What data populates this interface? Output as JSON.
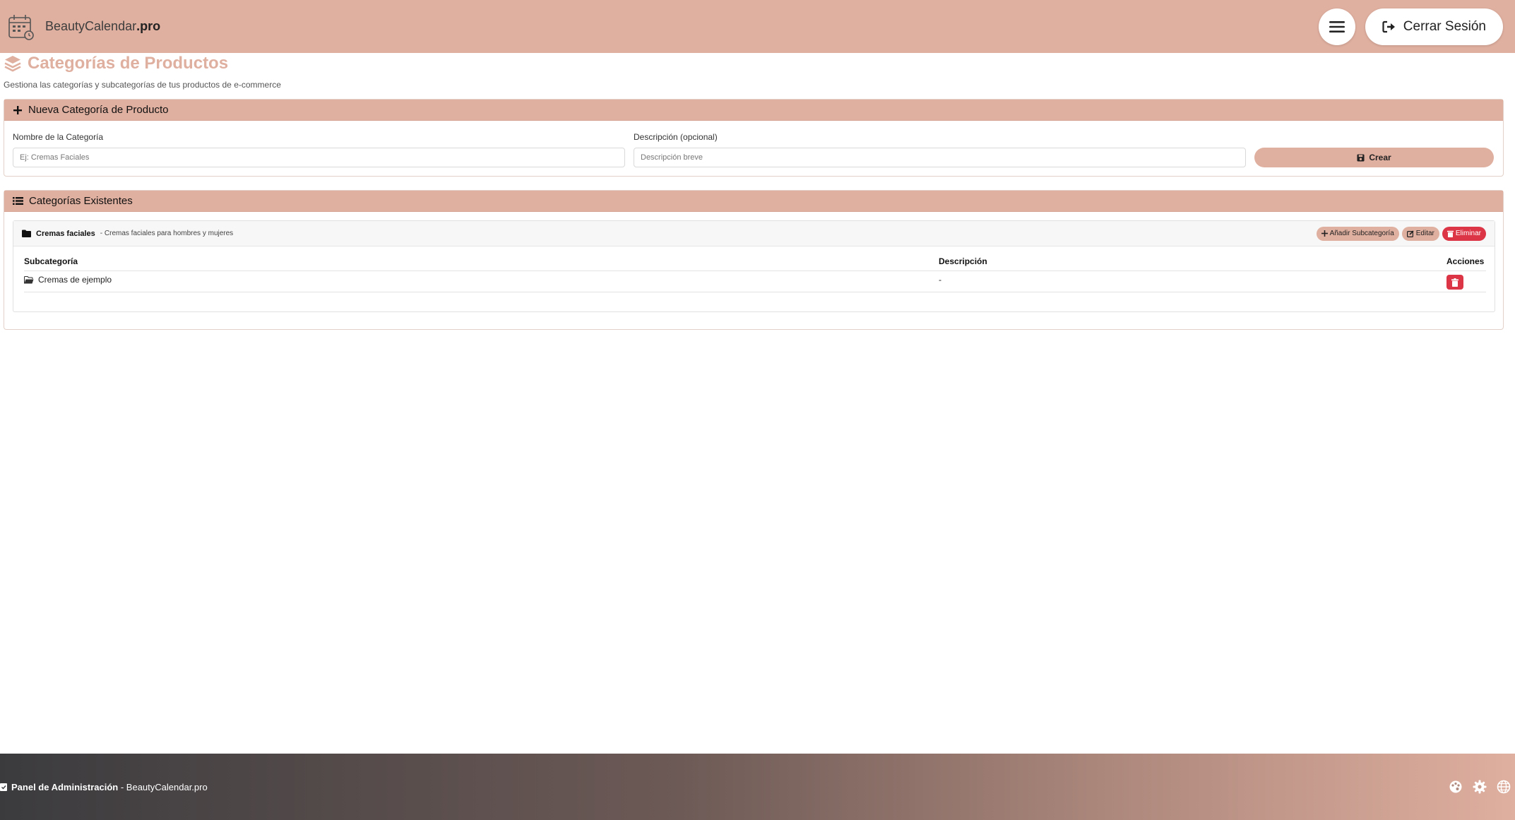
{
  "header": {
    "brand_name": "BeautyCalendar",
    "brand_suffix": ".pro",
    "menu_icon": "hamburger-icon",
    "logout_label": "Cerrar Sesión",
    "logout_icon": "sign-out-icon",
    "accent_color": "#dfaf9f"
  },
  "page": {
    "title": "Categorías de Productos",
    "title_icon": "layers-icon",
    "subtitle": "Gestiona las categorías y subcategorías de tus productos de e-commerce"
  },
  "new_category": {
    "header": "Nueva Categoría de Producto",
    "header_icon": "plus-icon",
    "name_label": "Nombre de la Categoría",
    "name_placeholder": "Ej: Cremas Faciales",
    "name_value": "",
    "desc_label": "Descripción (opcional)",
    "desc_placeholder": "Descripción breve",
    "desc_value": "",
    "create_label": "Crear",
    "create_icon": "save-icon"
  },
  "existing": {
    "header": "Categorías Existentes",
    "header_icon": "list-icon",
    "categories": [
      {
        "name": "Cremas faciales",
        "separator": " - ",
        "description": "Cremas faciales para hombres y mujeres",
        "icon": "folder-icon",
        "actions": {
          "add_sub": "Añadir Subcategoría",
          "edit": "Editar",
          "delete": "Eliminar"
        },
        "columns": [
          "Subcategoría",
          "Descripción",
          "Acciones"
        ],
        "subcategories": [
          {
            "name": "Cremas de ejemplo",
            "description": "-",
            "icon": "folder-open-icon"
          }
        ]
      }
    ]
  },
  "footer": {
    "title": "Panel de Administración",
    "separator": " - ",
    "site": "BeautyCalendar.pro",
    "icons": [
      "palette-icon",
      "gear-icon",
      "globe-icon"
    ],
    "danger_color": "#dc3545"
  }
}
